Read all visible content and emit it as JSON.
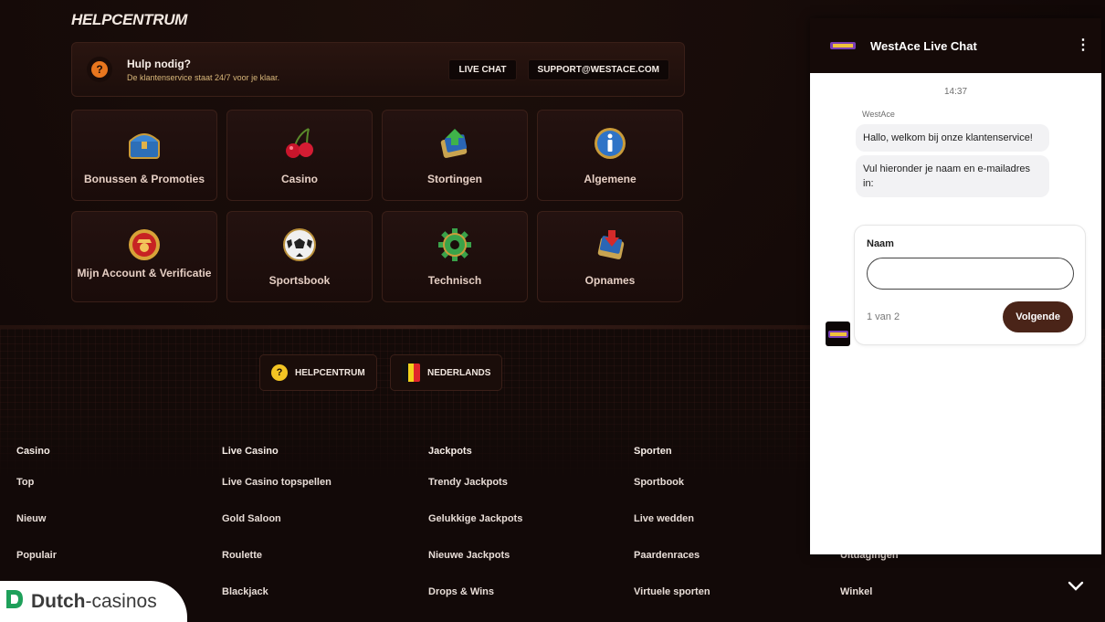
{
  "help_center": {
    "title": "HELPCENTRUM",
    "banner": {
      "heading": "Hulp nodig?",
      "subtext": "De klantenservice staat 24/7 voor je klaar.",
      "live_chat_label": "LIVE CHAT",
      "support_email_label": "SUPPORT@WESTACE.COM",
      "icon_glyph": "?"
    },
    "categories": [
      {
        "label": "Bonussen & Promoties",
        "icon": "treasure-chest-icon"
      },
      {
        "label": "Casino",
        "icon": "cherries-icon"
      },
      {
        "label": "Stortingen",
        "icon": "deposit-arrow-icon"
      },
      {
        "label": "Algemene",
        "icon": "info-chip-icon"
      },
      {
        "label": "Mijn Account & Verificatie",
        "icon": "account-badge-icon"
      },
      {
        "label": "Sportsbook",
        "icon": "soccer-ball-icon"
      },
      {
        "label": "Technisch",
        "icon": "gear-icon"
      },
      {
        "label": "Opnames",
        "icon": "withdraw-arrow-icon"
      }
    ]
  },
  "footer": {
    "helpcenter_pill": "HELPCENTRUM",
    "language_pill": "NEDERLANDS",
    "columns": [
      {
        "heading": "Casino",
        "items": [
          "Top",
          "Nieuw",
          "Populair"
        ]
      },
      {
        "heading": "Live Casino",
        "items": [
          "Live Casino topspellen",
          "Gold Saloon",
          "Roulette",
          "Blackjack"
        ]
      },
      {
        "heading": "Jackpots",
        "items": [
          "Trendy Jackpots",
          "Gelukkige Jackpots",
          "Nieuwe Jackpots",
          "Drops & Wins"
        ]
      },
      {
        "heading": "Sporten",
        "items": [
          "Sportbook",
          "Live wedden",
          "Paardenraces",
          "Virtuele sporten"
        ]
      },
      {
        "heading": "",
        "items": [
          "",
          "",
          "Uitdagingen",
          "Winkel"
        ]
      }
    ]
  },
  "chat": {
    "title": "WestAce Live Chat",
    "menu_glyph": "⋮",
    "time": "14:37",
    "sender": "WestAce",
    "messages": [
      "Hallo, welkom bij onze klantenservice!",
      "Vul hieronder je naam en e-mailadres in:"
    ],
    "form": {
      "label": "Naam",
      "value": "",
      "step": "1 van 2",
      "next_label": "Volgende"
    }
  },
  "watermark": {
    "brand_bold": "Dutch",
    "brand_rest": "-casinos"
  },
  "colors": {
    "accent_orange": "#e8761e",
    "gold": "#f3c423",
    "chat_button": "#4a2418",
    "background": "#120908"
  }
}
